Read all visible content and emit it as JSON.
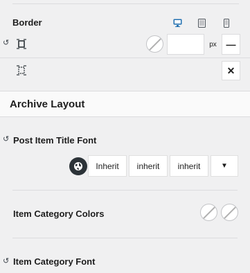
{
  "border": {
    "label": "Border",
    "devices": [
      "desktop-icon",
      "tablet-icon",
      "mobile-icon"
    ],
    "active_device_color": "#2271b1",
    "row1": {
      "value": "",
      "unit": "px",
      "style_symbol": "—"
    },
    "clear_symbol": "✕"
  },
  "archive": {
    "title": "Archive Layout",
    "title_font": {
      "label": "Post Item Title Font",
      "family": "Inherit",
      "weight": "inherit",
      "style": "inherit",
      "dropdown_symbol": "▼"
    },
    "category_colors": {
      "label": "Item Category Colors"
    },
    "category_font": {
      "label": "Item Category Font"
    }
  },
  "reset_symbol": "↺"
}
